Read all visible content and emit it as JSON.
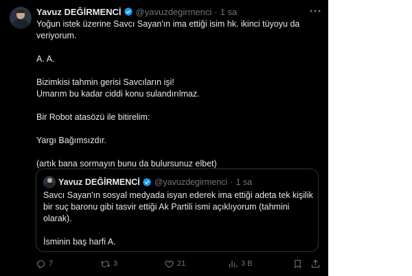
{
  "author": {
    "name": "Yavuz DEĞİRMENCİ",
    "handle": "@yavuzdegirmenci",
    "separator": "·",
    "time": "1 sa"
  },
  "tweet": {
    "lines": [
      "Yoğun istek üzerine Savcı Sayan'ın ima ettiği isim hk. ikinci tüyoyu da",
      "veriyorum.",
      "A. A.",
      "Bizimkisi tahmin gerisi Savcıların işi!",
      "Umarım bu kadar ciddi konu sulandırılmaz.",
      "Bir Robot atasözü ile bitirelim:",
      "Yargı Bağımsızdır.",
      "(artık bana sormayın bunu da bulursunuz elbet)"
    ]
  },
  "quoted": {
    "name": "Yavuz DEĞİRMENCİ",
    "handle": "@yavuzdegirmenci",
    "separator": "·",
    "time": "1 sa",
    "lines": [
      "Savcı Sayan'ın sosyal medyada isyan ederek ima ettiği adeta tek kişilik",
      "bir suç baronu gibi tasvir ettiği Ak Partili ismi açıklıyorum (tahmini",
      "olarak).",
      "İsminin baş harfi A."
    ]
  },
  "actions": {
    "replies": "7",
    "reposts": "3",
    "likes": "21",
    "views": "3 B"
  },
  "icons": {
    "verified": "verified-badge-icon",
    "more": "more-icon",
    "reply": "reply-icon",
    "repost": "repost-icon",
    "like": "like-icon",
    "views": "views-icon",
    "bookmark": "bookmark-icon",
    "share": "share-icon"
  },
  "colors": {
    "background": "#000000",
    "text": "#e7e9ea",
    "muted": "#71767b",
    "verified": "#1d9bf0",
    "border": "#2f3336"
  }
}
